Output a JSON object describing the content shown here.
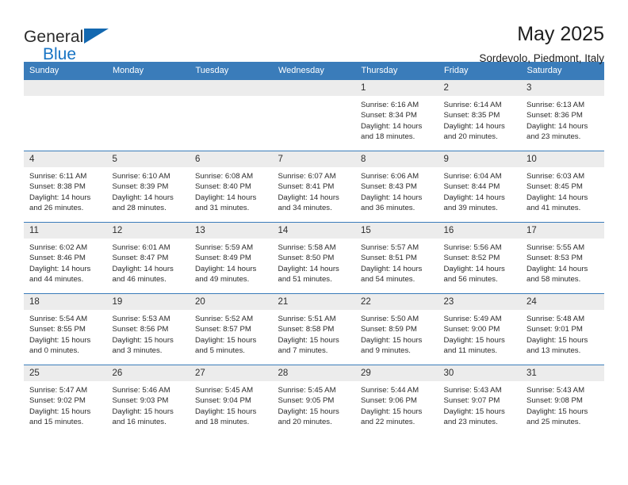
{
  "brand": {
    "line1": "General",
    "line2": "Blue",
    "triangle_color": "#1368b0",
    "blue_color": "#1874c4"
  },
  "header": {
    "title": "May 2025",
    "subtitle": "Sordevolo, Piedmont, Italy"
  },
  "theme": {
    "header_bg": "#3a7cba",
    "header_text": "#ffffff",
    "daynum_bg": "#ececec",
    "grid_line": "#3a7cba"
  },
  "calendar": {
    "weekday_headers": [
      "Sunday",
      "Monday",
      "Tuesday",
      "Wednesday",
      "Thursday",
      "Friday",
      "Saturday"
    ],
    "weeks": [
      [
        {
          "day": "",
          "sunrise": "",
          "sunset": "",
          "daylight_line1": "",
          "daylight_line2": ""
        },
        {
          "day": "",
          "sunrise": "",
          "sunset": "",
          "daylight_line1": "",
          "daylight_line2": ""
        },
        {
          "day": "",
          "sunrise": "",
          "sunset": "",
          "daylight_line1": "",
          "daylight_line2": ""
        },
        {
          "day": "",
          "sunrise": "",
          "sunset": "",
          "daylight_line1": "",
          "daylight_line2": ""
        },
        {
          "day": "1",
          "sunrise": "Sunrise: 6:16 AM",
          "sunset": "Sunset: 8:34 PM",
          "daylight_line1": "Daylight: 14 hours",
          "daylight_line2": "and 18 minutes."
        },
        {
          "day": "2",
          "sunrise": "Sunrise: 6:14 AM",
          "sunset": "Sunset: 8:35 PM",
          "daylight_line1": "Daylight: 14 hours",
          "daylight_line2": "and 20 minutes."
        },
        {
          "day": "3",
          "sunrise": "Sunrise: 6:13 AM",
          "sunset": "Sunset: 8:36 PM",
          "daylight_line1": "Daylight: 14 hours",
          "daylight_line2": "and 23 minutes."
        }
      ],
      [
        {
          "day": "4",
          "sunrise": "Sunrise: 6:11 AM",
          "sunset": "Sunset: 8:38 PM",
          "daylight_line1": "Daylight: 14 hours",
          "daylight_line2": "and 26 minutes."
        },
        {
          "day": "5",
          "sunrise": "Sunrise: 6:10 AM",
          "sunset": "Sunset: 8:39 PM",
          "daylight_line1": "Daylight: 14 hours",
          "daylight_line2": "and 28 minutes."
        },
        {
          "day": "6",
          "sunrise": "Sunrise: 6:08 AM",
          "sunset": "Sunset: 8:40 PM",
          "daylight_line1": "Daylight: 14 hours",
          "daylight_line2": "and 31 minutes."
        },
        {
          "day": "7",
          "sunrise": "Sunrise: 6:07 AM",
          "sunset": "Sunset: 8:41 PM",
          "daylight_line1": "Daylight: 14 hours",
          "daylight_line2": "and 34 minutes."
        },
        {
          "day": "8",
          "sunrise": "Sunrise: 6:06 AM",
          "sunset": "Sunset: 8:43 PM",
          "daylight_line1": "Daylight: 14 hours",
          "daylight_line2": "and 36 minutes."
        },
        {
          "day": "9",
          "sunrise": "Sunrise: 6:04 AM",
          "sunset": "Sunset: 8:44 PM",
          "daylight_line1": "Daylight: 14 hours",
          "daylight_line2": "and 39 minutes."
        },
        {
          "day": "10",
          "sunrise": "Sunrise: 6:03 AM",
          "sunset": "Sunset: 8:45 PM",
          "daylight_line1": "Daylight: 14 hours",
          "daylight_line2": "and 41 minutes."
        }
      ],
      [
        {
          "day": "11",
          "sunrise": "Sunrise: 6:02 AM",
          "sunset": "Sunset: 8:46 PM",
          "daylight_line1": "Daylight: 14 hours",
          "daylight_line2": "and 44 minutes."
        },
        {
          "day": "12",
          "sunrise": "Sunrise: 6:01 AM",
          "sunset": "Sunset: 8:47 PM",
          "daylight_line1": "Daylight: 14 hours",
          "daylight_line2": "and 46 minutes."
        },
        {
          "day": "13",
          "sunrise": "Sunrise: 5:59 AM",
          "sunset": "Sunset: 8:49 PM",
          "daylight_line1": "Daylight: 14 hours",
          "daylight_line2": "and 49 minutes."
        },
        {
          "day": "14",
          "sunrise": "Sunrise: 5:58 AM",
          "sunset": "Sunset: 8:50 PM",
          "daylight_line1": "Daylight: 14 hours",
          "daylight_line2": "and 51 minutes."
        },
        {
          "day": "15",
          "sunrise": "Sunrise: 5:57 AM",
          "sunset": "Sunset: 8:51 PM",
          "daylight_line1": "Daylight: 14 hours",
          "daylight_line2": "and 54 minutes."
        },
        {
          "day": "16",
          "sunrise": "Sunrise: 5:56 AM",
          "sunset": "Sunset: 8:52 PM",
          "daylight_line1": "Daylight: 14 hours",
          "daylight_line2": "and 56 minutes."
        },
        {
          "day": "17",
          "sunrise": "Sunrise: 5:55 AM",
          "sunset": "Sunset: 8:53 PM",
          "daylight_line1": "Daylight: 14 hours",
          "daylight_line2": "and 58 minutes."
        }
      ],
      [
        {
          "day": "18",
          "sunrise": "Sunrise: 5:54 AM",
          "sunset": "Sunset: 8:55 PM",
          "daylight_line1": "Daylight: 15 hours",
          "daylight_line2": "and 0 minutes."
        },
        {
          "day": "19",
          "sunrise": "Sunrise: 5:53 AM",
          "sunset": "Sunset: 8:56 PM",
          "daylight_line1": "Daylight: 15 hours",
          "daylight_line2": "and 3 minutes."
        },
        {
          "day": "20",
          "sunrise": "Sunrise: 5:52 AM",
          "sunset": "Sunset: 8:57 PM",
          "daylight_line1": "Daylight: 15 hours",
          "daylight_line2": "and 5 minutes."
        },
        {
          "day": "21",
          "sunrise": "Sunrise: 5:51 AM",
          "sunset": "Sunset: 8:58 PM",
          "daylight_line1": "Daylight: 15 hours",
          "daylight_line2": "and 7 minutes."
        },
        {
          "day": "22",
          "sunrise": "Sunrise: 5:50 AM",
          "sunset": "Sunset: 8:59 PM",
          "daylight_line1": "Daylight: 15 hours",
          "daylight_line2": "and 9 minutes."
        },
        {
          "day": "23",
          "sunrise": "Sunrise: 5:49 AM",
          "sunset": "Sunset: 9:00 PM",
          "daylight_line1": "Daylight: 15 hours",
          "daylight_line2": "and 11 minutes."
        },
        {
          "day": "24",
          "sunrise": "Sunrise: 5:48 AM",
          "sunset": "Sunset: 9:01 PM",
          "daylight_line1": "Daylight: 15 hours",
          "daylight_line2": "and 13 minutes."
        }
      ],
      [
        {
          "day": "25",
          "sunrise": "Sunrise: 5:47 AM",
          "sunset": "Sunset: 9:02 PM",
          "daylight_line1": "Daylight: 15 hours",
          "daylight_line2": "and 15 minutes."
        },
        {
          "day": "26",
          "sunrise": "Sunrise: 5:46 AM",
          "sunset": "Sunset: 9:03 PM",
          "daylight_line1": "Daylight: 15 hours",
          "daylight_line2": "and 16 minutes."
        },
        {
          "day": "27",
          "sunrise": "Sunrise: 5:45 AM",
          "sunset": "Sunset: 9:04 PM",
          "daylight_line1": "Daylight: 15 hours",
          "daylight_line2": "and 18 minutes."
        },
        {
          "day": "28",
          "sunrise": "Sunrise: 5:45 AM",
          "sunset": "Sunset: 9:05 PM",
          "daylight_line1": "Daylight: 15 hours",
          "daylight_line2": "and 20 minutes."
        },
        {
          "day": "29",
          "sunrise": "Sunrise: 5:44 AM",
          "sunset": "Sunset: 9:06 PM",
          "daylight_line1": "Daylight: 15 hours",
          "daylight_line2": "and 22 minutes."
        },
        {
          "day": "30",
          "sunrise": "Sunrise: 5:43 AM",
          "sunset": "Sunset: 9:07 PM",
          "daylight_line1": "Daylight: 15 hours",
          "daylight_line2": "and 23 minutes."
        },
        {
          "day": "31",
          "sunrise": "Sunrise: 5:43 AM",
          "sunset": "Sunset: 9:08 PM",
          "daylight_line1": "Daylight: 15 hours",
          "daylight_line2": "and 25 minutes."
        }
      ]
    ]
  }
}
